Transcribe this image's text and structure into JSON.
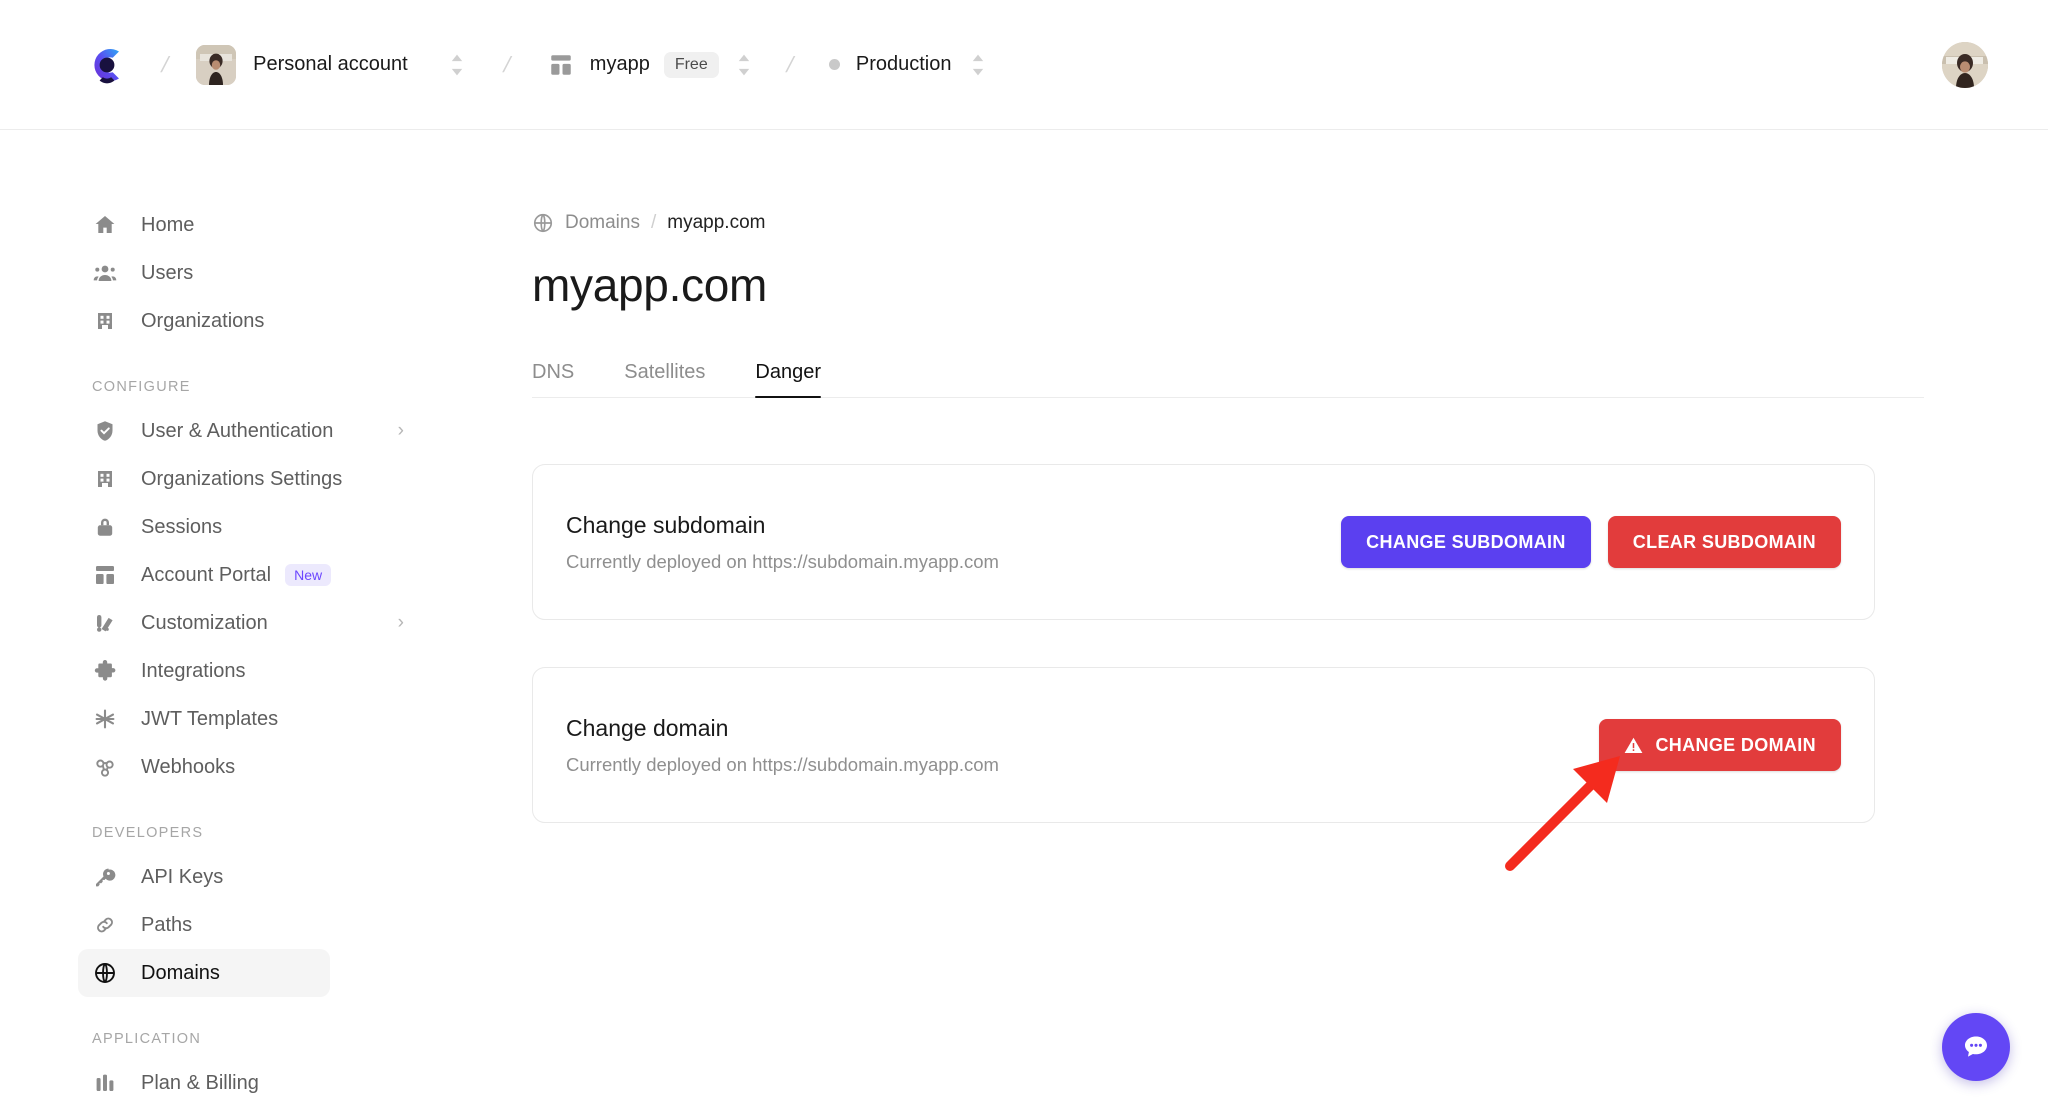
{
  "header": {
    "logo_name": "clerk-logo",
    "account": {
      "label": "Personal account",
      "avatar": "user-photo-avatar"
    },
    "app": {
      "label": "myapp",
      "plan_badge": "Free",
      "icon": "app-grid-icon"
    },
    "environment": {
      "label": "Production",
      "status_dot": "gray"
    },
    "separator": "/",
    "user_avatar": "profile-photo-avatar"
  },
  "sidebar": {
    "primary": [
      {
        "label": "Home",
        "icon": "home-icon"
      },
      {
        "label": "Users",
        "icon": "users-icon"
      },
      {
        "label": "Organizations",
        "icon": "organizations-icon"
      }
    ],
    "configure_heading": "CONFIGURE",
    "configure": [
      {
        "label": "User & Authentication",
        "icon": "shield-check-icon",
        "chevron": "›"
      },
      {
        "label": "Organizations Settings",
        "icon": "organizations-icon"
      },
      {
        "label": "Sessions",
        "icon": "lock-icon"
      },
      {
        "label": "Account Portal",
        "icon": "layout-icon",
        "badge": "New"
      },
      {
        "label": "Customization",
        "icon": "customization-icon",
        "chevron": "›"
      },
      {
        "label": "Integrations",
        "icon": "puzzle-icon"
      },
      {
        "label": "JWT Templates",
        "icon": "asterisk-icon"
      },
      {
        "label": "Webhooks",
        "icon": "webhooks-icon"
      }
    ],
    "developers_heading": "DEVELOPERS",
    "developers": [
      {
        "label": "API Keys",
        "icon": "key-icon"
      },
      {
        "label": "Paths",
        "icon": "link-icon"
      },
      {
        "label": "Domains",
        "icon": "globe-icon",
        "active": true
      }
    ],
    "application_heading": "APPLICATION",
    "application": [
      {
        "label": "Plan & Billing",
        "icon": "billing-icon"
      }
    ]
  },
  "main": {
    "breadcrumb": {
      "icon": "globe-icon",
      "parent": "Domains",
      "separator": "/",
      "current": "myapp.com"
    },
    "page_title": "myapp.com",
    "tabs": [
      {
        "label": "DNS",
        "active": false
      },
      {
        "label": "Satellites",
        "active": false
      },
      {
        "label": "Danger",
        "active": true
      }
    ],
    "cards": [
      {
        "title": "Change subdomain",
        "subtitle": "Currently deployed on https://subdomain.myapp.com",
        "buttons": [
          {
            "label": "CHANGE SUBDOMAIN",
            "style": "purple"
          },
          {
            "label": "CLEAR SUBDOMAIN",
            "style": "red"
          }
        ]
      },
      {
        "title": "Change domain",
        "subtitle": "Currently deployed on https://subdomain.myapp.com",
        "buttons": [
          {
            "label": "CHANGE DOMAIN",
            "style": "red",
            "icon": "warning-triangle-icon"
          }
        ]
      }
    ]
  },
  "annotation": {
    "arrow": "red-pointer-arrow",
    "color": "#f42b1e",
    "points_to": "CHANGE DOMAIN"
  },
  "chat_widget": {
    "icon": "chat-bubble-icon",
    "color": "#6347f5"
  },
  "colors": {
    "accent_purple": "#5b40f0",
    "danger_red": "#e23c3c",
    "badge_purple_bg": "#ece9fd",
    "badge_purple_text": "#6c47ff",
    "active_nav_bg": "#f5f5f5"
  }
}
